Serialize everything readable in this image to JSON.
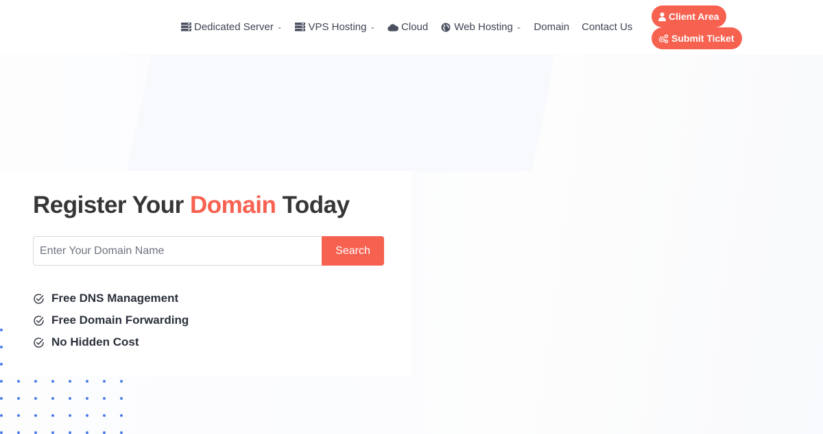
{
  "header": {
    "nav": [
      {
        "label": "Dedicated Server",
        "icon": "server-icon",
        "dropdown": true
      },
      {
        "label": "VPS Hosting",
        "icon": "server-icon",
        "dropdown": true
      },
      {
        "label": "Cloud",
        "icon": "cloud-icon",
        "dropdown": false
      },
      {
        "label": "Web Hosting",
        "icon": "globe-icon",
        "dropdown": true
      },
      {
        "label": "Domain",
        "icon": null,
        "dropdown": false
      },
      {
        "label": "Contact Us",
        "icon": null,
        "dropdown": false
      }
    ],
    "client_area_label": "Client Area",
    "submit_ticket_label": "Submit Ticket",
    "chevron_glyph": "⌄"
  },
  "hero": {
    "title_prefix": "Register Your ",
    "title_accent": "Domain",
    "title_suffix": " Today",
    "search": {
      "value": "",
      "placeholder": "Enter Your Domain Name",
      "button_label": "Search"
    },
    "features": [
      "Free DNS Management",
      "Free Domain Forwarding",
      "No Hidden Cost"
    ]
  },
  "colors": {
    "accent": "#f76150",
    "nav_text": "#3d4352",
    "heading": "#363636",
    "dots": "#4a7bea"
  }
}
